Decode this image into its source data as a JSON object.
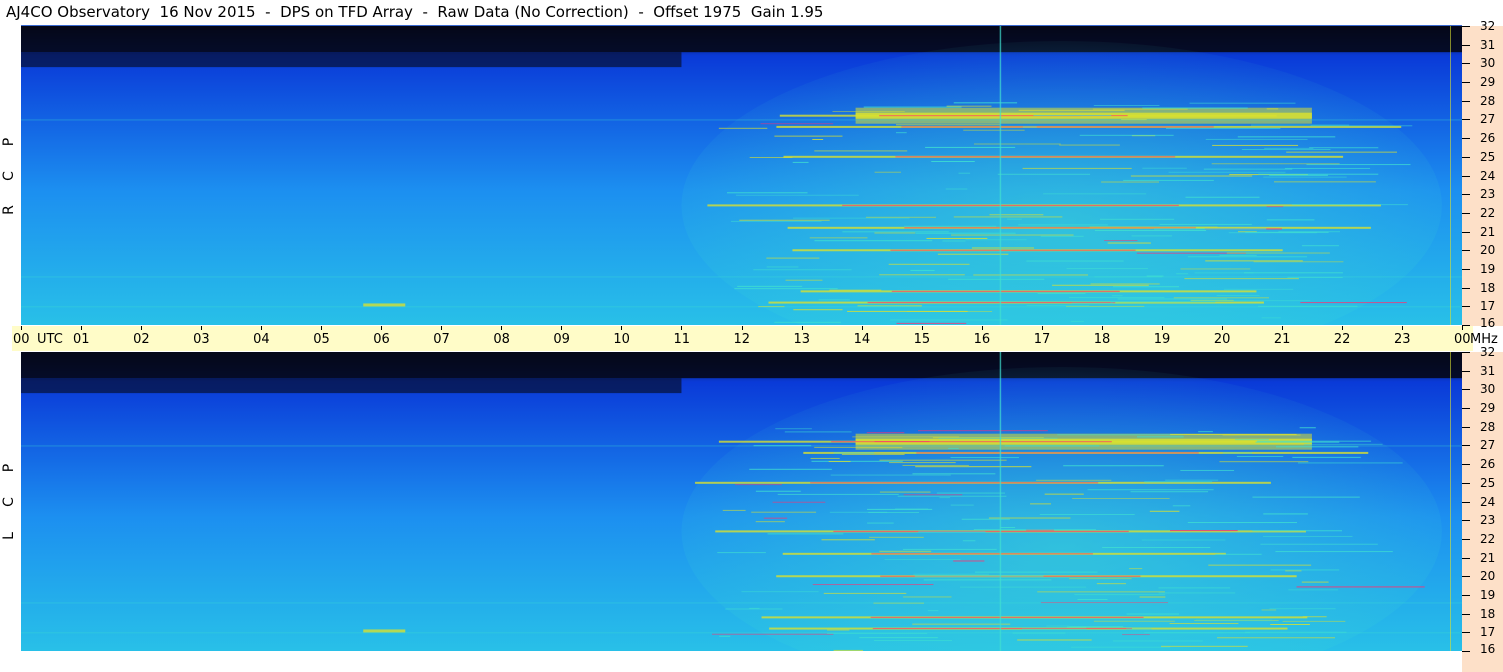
{
  "title": "AJ4CO Observatory  16 Nov 2015  -  DPS on TFD Array  -  Raw Data (No Correction)  -  Offset 1975  Gain 1.95",
  "panels": [
    {
      "id": "rcp",
      "letters": [
        "P",
        "C",
        "R"
      ]
    },
    {
      "id": "lcp",
      "letters": [
        "P",
        "C",
        "L"
      ]
    }
  ],
  "time_axis": {
    "labels": [
      "00",
      "01",
      "02",
      "03",
      "04",
      "05",
      "06",
      "07",
      "08",
      "09",
      "10",
      "11",
      "12",
      "13",
      "14",
      "15",
      "16",
      "17",
      "18",
      "19",
      "20",
      "21",
      "22",
      "23",
      "00"
    ],
    "unit_left": "UTC",
    "unit_right": "MHz"
  },
  "freq_axis": {
    "labels": [
      "32",
      "31",
      "30",
      "29",
      "28",
      "27",
      "26",
      "25",
      "24",
      "23",
      "22",
      "21",
      "20",
      "19",
      "18",
      "17",
      "16"
    ]
  },
  "chart_data": {
    "type": "heatmap",
    "title": "AJ4CO Observatory  16 Nov 2015  -  DPS on TFD Array  -  Raw Data (No Correction)  -  Offset 1975  Gain 1.95",
    "xlabel": "UTC",
    "ylabel": "MHz",
    "xlim": [
      0,
      24
    ],
    "ylim": [
      16,
      32
    ],
    "series": [
      {
        "name": "RCP"
      },
      {
        "name": "LCP"
      }
    ],
    "bright_bands_mhz": [
      27.2,
      26.6,
      25,
      22.4,
      21.2,
      20,
      17.8,
      17.2
    ],
    "activity_window_utc": [
      12,
      22
    ]
  },
  "colors": {
    "background_dark": "#050818",
    "low": "#0a3ad8",
    "mid": "#1c8ff0",
    "high": "#40e0d0",
    "band": "#d8e030",
    "peak": "#ff3070",
    "time_strip": "#fffcc8",
    "freq_strip": "#fde0c8"
  }
}
